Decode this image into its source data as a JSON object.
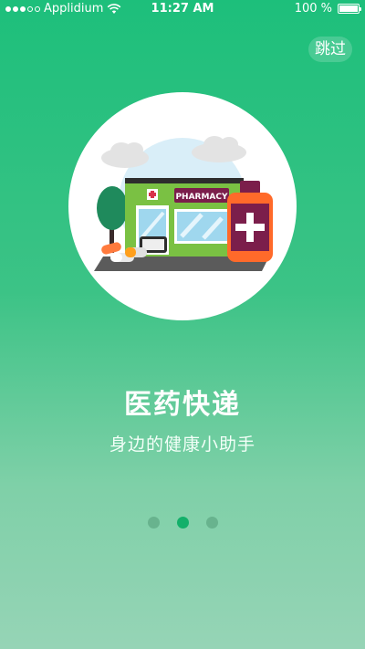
{
  "status_bar": {
    "carrier": "Applidium",
    "time": "11:27 AM",
    "battery": "100 %",
    "signal_dots": [
      true,
      true,
      true,
      false,
      false
    ]
  },
  "skip_label": "跳过",
  "illustration": {
    "sign_text": "PHARMACY"
  },
  "onboarding": {
    "title": "医药快递",
    "subtitle": "身边的健康小助手"
  },
  "pager": {
    "total": 3,
    "active_index": 1
  },
  "colors": {
    "background_top": "#1dbf7b",
    "background_bottom": "#96d4b6",
    "active_dot": "#13b06a",
    "inactive_dot": "#5fa884"
  }
}
